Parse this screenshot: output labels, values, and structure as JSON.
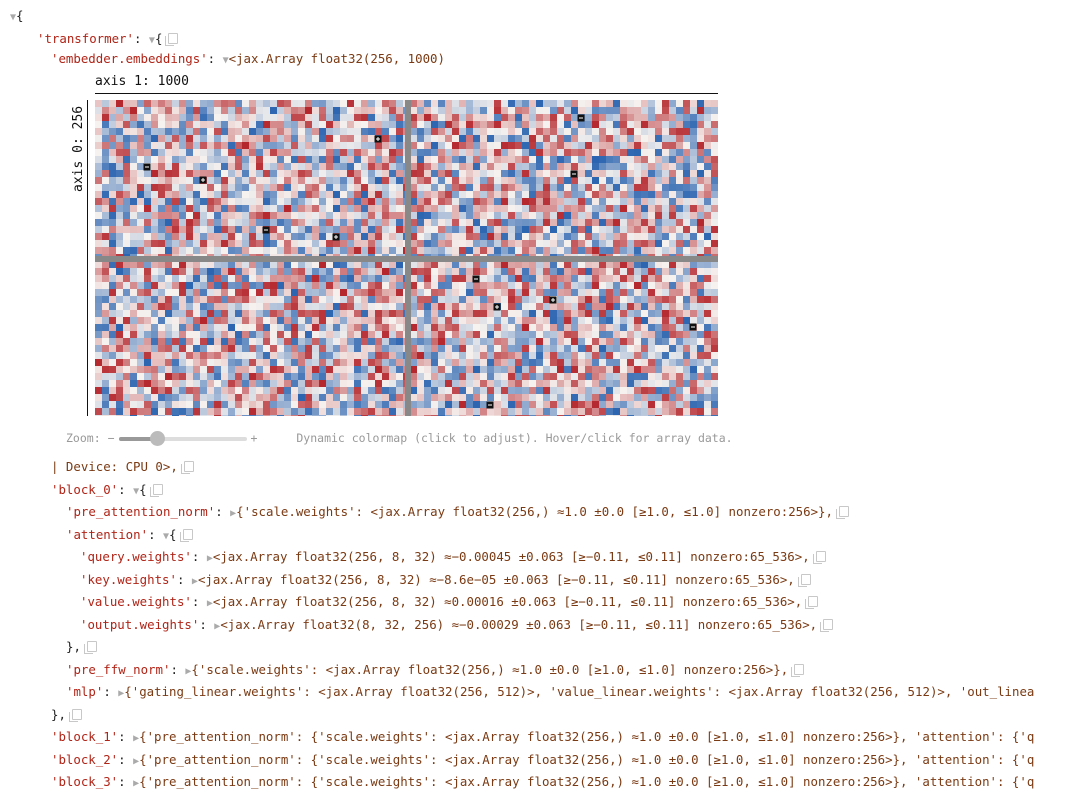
{
  "root_open": "{",
  "transformer_key": "'transformer'",
  "colon": ":",
  "open_brace": "{",
  "embeddings_key": "'embedder.embeddings'",
  "embeddings_type": "<jax.Array float32(256, 1000)",
  "heatmap": {
    "axis1_label": "axis 1: 1000",
    "axis0_label": "axis 0: 256",
    "colors": {
      "neg": "#2b64b0",
      "pos": "#b4262c",
      "mid": "#f6f2ef",
      "separator": "#888888"
    }
  },
  "zoom": {
    "label": "Zoom:",
    "minus": "−",
    "plus": "+",
    "level": 0.3,
    "colormap_hint": "Dynamic colormap (click to adjust). Hover/click for array data."
  },
  "device_line": "| Device: CPU 0>,",
  "block0": {
    "key": "'block_0'",
    "pre_attention_norm_key": "'pre_attention_norm'",
    "pre_attention_norm_value": "{'scale.weights': <jax.Array float32(256,) ≈1.0 ±0.0 [≥1.0, ≤1.0] nonzero:256>},",
    "attention_key": "'attention'",
    "query_key": "'query.weights'",
    "query_value": "<jax.Array float32(256, 8, 32) ≈−0.00045 ±0.063 [≥−0.11, ≤0.11] nonzero:65_536>,",
    "key_key": "'key.weights'",
    "key_value": "<jax.Array float32(256, 8, 32) ≈−8.6e−05 ±0.063 [≥−0.11, ≤0.11] nonzero:65_536>,",
    "value_key": "'value.weights'",
    "value_value": "<jax.Array float32(256, 8, 32) ≈0.00016 ±0.063 [≥−0.11, ≤0.11] nonzero:65_536>,",
    "output_key": "'output.weights'",
    "output_value": "<jax.Array float32(8, 32, 256) ≈−0.00029 ±0.063 [≥−0.11, ≤0.11] nonzero:65_536>,",
    "attention_close": "},",
    "pre_ffw_norm_key": "'pre_ffw_norm'",
    "pre_ffw_norm_value": "{'scale.weights': <jax.Array float32(256,) ≈1.0 ±0.0 [≥1.0, ≤1.0] nonzero:256>},",
    "mlp_key": "'mlp'",
    "mlp_value": "{'gating_linear.weights': <jax.Array float32(256, 512)>, 'value_linear.weights': <jax.Array float32(256, 512)>, 'out_linea",
    "close": "},"
  },
  "block1": {
    "key": "'block_1'",
    "value": "{'pre_attention_norm': {'scale.weights': <jax.Array float32(256,) ≈1.0 ±0.0 [≥1.0, ≤1.0] nonzero:256>}, 'attention': {'q"
  },
  "block2": {
    "key": "'block_2'",
    "value": "{'pre_attention_norm': {'scale.weights': <jax.Array float32(256,) ≈1.0 ±0.0 [≥1.0, ≤1.0] nonzero:256>}, 'attention': {'q"
  },
  "block3": {
    "key": "'block_3'",
    "value": "{'pre_attention_norm': {'scale.weights': <jax.Array float32(256,) ≈1.0 ±0.0 [≥1.0, ≤1.0] nonzero:256>}, 'attention': {'q"
  }
}
